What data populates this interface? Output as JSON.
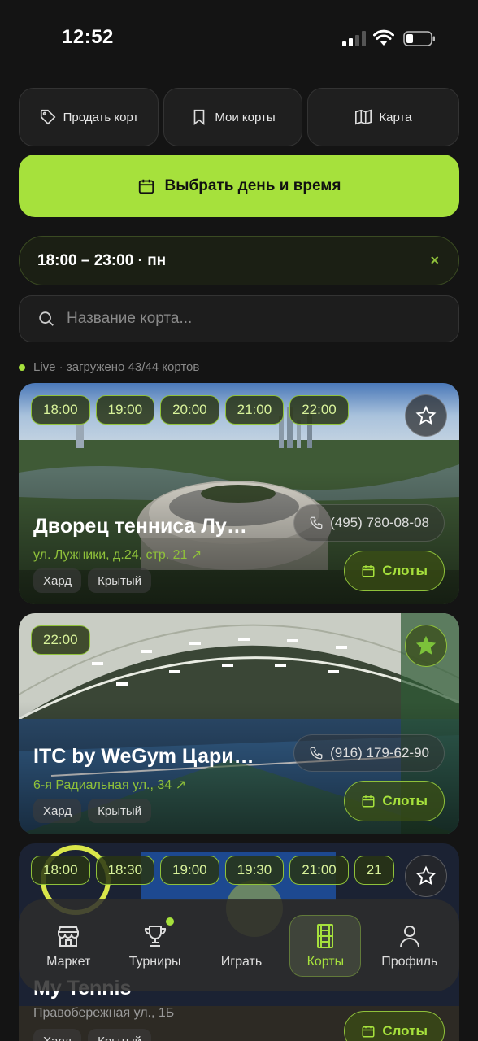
{
  "status_bar": {
    "time": "12:52"
  },
  "top_buttons": {
    "sell": "Продать корт",
    "my_courts": "Мои корты",
    "map": "Карта"
  },
  "primary_button": "Выбрать день и время",
  "filter": {
    "label": "18:00 – 23:00 · пн",
    "clear": "×"
  },
  "search": {
    "placeholder": "Название корта..."
  },
  "live_status": "Live · загружено 43/44 кортов",
  "courts": [
    {
      "slots": [
        "18:00",
        "19:00",
        "20:00",
        "21:00",
        "22:00"
      ],
      "title": "Дворец тенниса Лу…",
      "address": "ул. Лужники, д.24, стр. 21 ↗",
      "phone": "(495) 780-08-08",
      "tags": [
        "Хард",
        "Крытый"
      ],
      "slots_button": "Слоты",
      "favorite": false
    },
    {
      "slots": [
        "22:00"
      ],
      "title": "ITC by WeGym Цари…",
      "address": "6-я Радиальная ул., 34 ↗",
      "phone": "(916) 179-62-90",
      "tags": [
        "Хард",
        "Крытый"
      ],
      "slots_button": "Слоты",
      "favorite": true
    },
    {
      "slots": [
        "18:00",
        "18:30",
        "19:00",
        "19:30",
        "21:00",
        "21"
      ],
      "title": "My Tennis",
      "address": "Правобережная ул., 1Б",
      "phone": "",
      "tags": [
        "Хард",
        "Крытый"
      ],
      "slots_button": "Слоты",
      "favorite": false
    }
  ],
  "bottom_nav": {
    "market": "Маркет",
    "tournaments": "Турниры",
    "play": "Играть",
    "courts": "Корты",
    "profile": "Профиль"
  },
  "colors": {
    "accent": "#a6e13c",
    "background": "#141414"
  }
}
